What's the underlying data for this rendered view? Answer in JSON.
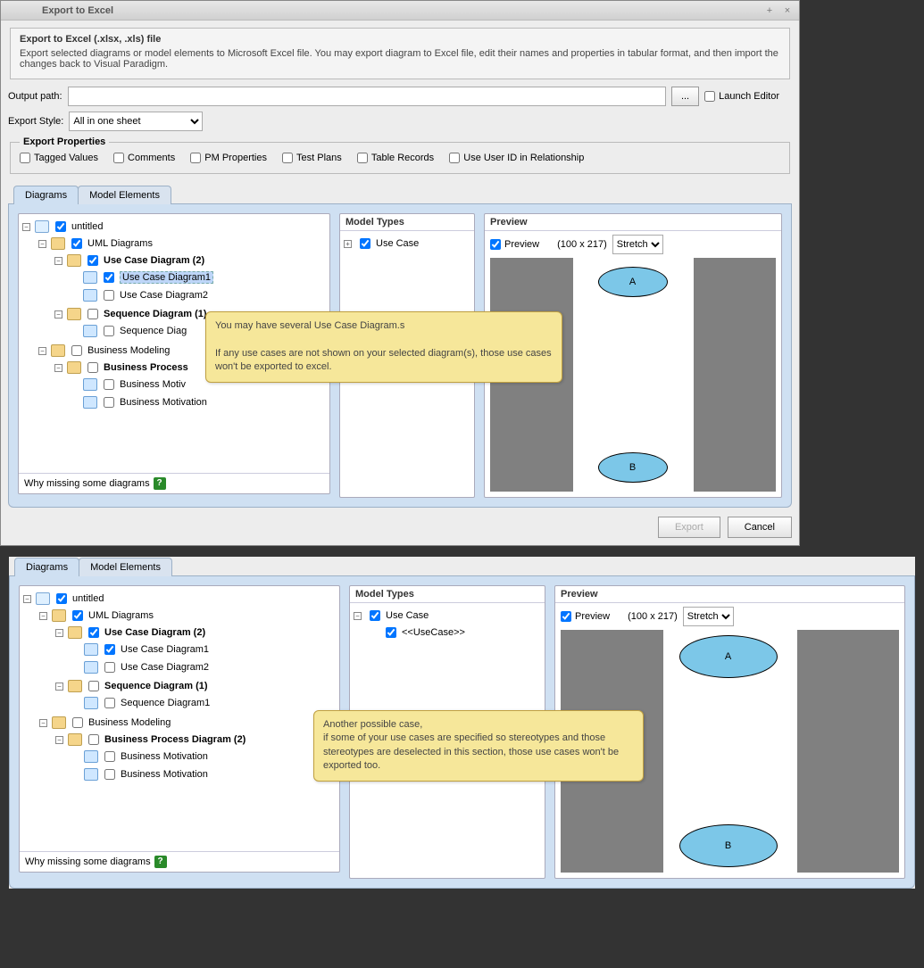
{
  "window": {
    "title": "Export to Excel",
    "min_icon": "+",
    "close_icon": "×"
  },
  "header": {
    "title": "Export to Excel (.xlsx, .xls) file",
    "desc": "Export selected diagrams or model elements to Microsoft Excel file. You may export diagram to Excel file, edit their names and properties in tabular format, and then import the changes back to Visual Paradigm."
  },
  "output": {
    "label": "Output path:",
    "value": "",
    "browse": "...",
    "launch_editor": "Launch Editor"
  },
  "export_style": {
    "label": "Export Style:",
    "value": "All in one sheet"
  },
  "props": {
    "legend": "Export Properties",
    "tagged": "Tagged Values",
    "comments": "Comments",
    "pm": "PM Properties",
    "test": "Test Plans",
    "table": "Table Records",
    "user_id": "Use User ID in Relationship"
  },
  "tabs": {
    "diagrams": "Diagrams",
    "model_elements": "Model Elements"
  },
  "tree": {
    "untitled": "untitled",
    "uml": "UML Diagrams",
    "usecase_cat": "Use Case Diagram (2)",
    "usecase1": "Use Case Diagram1",
    "usecase2": "Use Case Diagram2",
    "seq_cat": "Sequence Diagram (1)",
    "seq1": "Sequence Diag",
    "seq1_full": "Sequence Diagram1",
    "biz": "Business Modeling",
    "bpd": "Business Process",
    "bpd_full": "Business Process Diagram (2)",
    "bm1": "Business Motiv",
    "bm1_full": "Business Motivation",
    "bm2": "Business Motivation",
    "footer": "Why missing some diagrams"
  },
  "model_types": {
    "title": "Model Types",
    "usecase": "Use Case",
    "stereo": "<<UseCase>>"
  },
  "preview": {
    "title": "Preview",
    "checkbox": "Preview",
    "dims": "(100 x 217)",
    "stretch": "Stretch",
    "a": "A",
    "b": "B"
  },
  "tooltip1": "You may have several Use Case Diagram.s\n\nIf any use cases are not shown on your selected diagram(s), those use cases won't be exported to excel.",
  "tooltip2": "Another possible case,\nif some of your use cases are specified so stereotypes and those stereotypes are deselected in this section, those use cases won't be exported too.",
  "buttons": {
    "export": "Export",
    "cancel": "Cancel"
  }
}
